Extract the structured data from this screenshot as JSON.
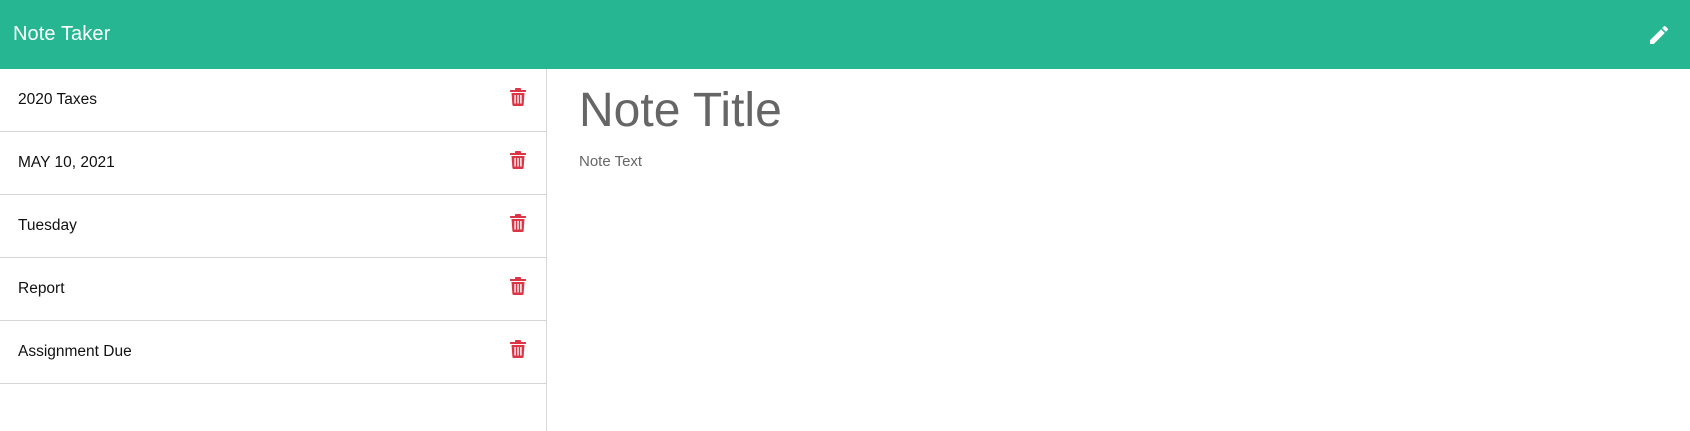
{
  "navbar": {
    "brand": "Note Taker",
    "new_note_icon": "pencil-icon"
  },
  "notes": [
    {
      "title": "2020 Taxes",
      "delete_icon": "trash-icon"
    },
    {
      "title": "MAY 10, 2021",
      "delete_icon": "trash-icon"
    },
    {
      "title": "Tuesday",
      "delete_icon": "trash-icon"
    },
    {
      "title": "Report",
      "delete_icon": "trash-icon"
    },
    {
      "title": "Assignment Due",
      "delete_icon": "trash-icon"
    }
  ],
  "editor": {
    "title_value": "",
    "title_placeholder": "Note Title",
    "text_value": "",
    "text_placeholder": "Note Text"
  },
  "colors": {
    "navbar_bg": "#26b792",
    "brand_text": "#ffffff",
    "delete_icon": "#dc3545",
    "placeholder": "#666666"
  }
}
